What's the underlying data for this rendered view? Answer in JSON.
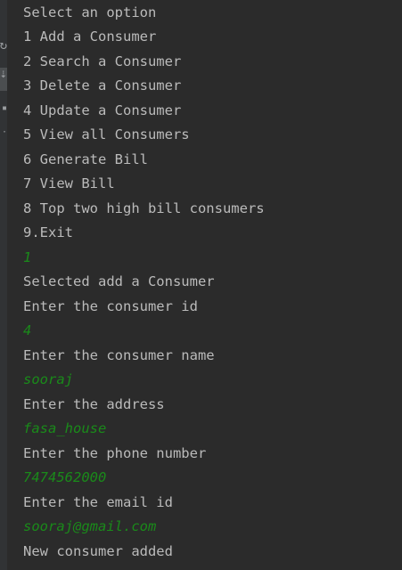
{
  "console": {
    "lines": [
      {
        "text": "Select an option",
        "kind": "output"
      },
      {
        "text": "1 Add a Consumer",
        "kind": "output"
      },
      {
        "text": "2 Search a Consumer",
        "kind": "output"
      },
      {
        "text": "3 Delete a Consumer",
        "kind": "output"
      },
      {
        "text": "4 Update a Consumer",
        "kind": "output"
      },
      {
        "text": "5 View all Consumers",
        "kind": "output"
      },
      {
        "text": "6 Generate Bill",
        "kind": "output"
      },
      {
        "text": "7 View Bill",
        "kind": "output"
      },
      {
        "text": "8 Top two high bill consumers",
        "kind": "output"
      },
      {
        "text": "9.Exit",
        "kind": "output"
      },
      {
        "text": "1",
        "kind": "input"
      },
      {
        "text": "Selected add a Consumer",
        "kind": "output"
      },
      {
        "text": "Enter the consumer id",
        "kind": "output"
      },
      {
        "text": "4",
        "kind": "input"
      },
      {
        "text": "Enter the consumer name",
        "kind": "output"
      },
      {
        "text": "sooraj",
        "kind": "input"
      },
      {
        "text": "Enter the address",
        "kind": "output"
      },
      {
        "text": "fasa_house",
        "kind": "input"
      },
      {
        "text": "Enter the phone number",
        "kind": "output"
      },
      {
        "text": "7474562000",
        "kind": "input"
      },
      {
        "text": "Enter the email id",
        "kind": "output"
      },
      {
        "text": "sooraj@gmail.com",
        "kind": "input"
      },
      {
        "text": "New consumer added",
        "kind": "output"
      }
    ]
  },
  "colors": {
    "background": "#2b2b2b",
    "output_text": "#bbbbbb",
    "input_text": "#1a8a1a",
    "gutter": "#313335"
  },
  "icons": {
    "gutter": [
      "restart-icon",
      "scroll-to-end-icon",
      "print-icon",
      "pin-icon"
    ]
  }
}
